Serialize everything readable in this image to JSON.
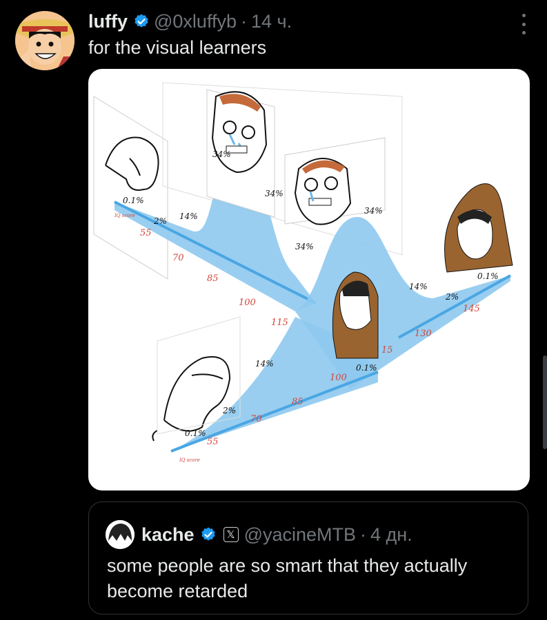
{
  "tweet": {
    "author_name": "luffy",
    "handle": "@0xluffyb",
    "time": "14 ч.",
    "separator": "·",
    "text": "for the visual learners",
    "avatar_icon": "avatar-straw-hat-icon",
    "verified_icon": "verified-badge-icon",
    "more_icon": "more-vertical-icon",
    "media": {
      "back_curve": {
        "percent_labels": [
          "0.1%",
          "2%",
          "14%",
          "34%",
          "34%"
        ],
        "iq_labels": [
          "IQ score",
          "55",
          "70",
          "85",
          "100",
          "115"
        ]
      },
      "mid_curve": {
        "percent_labels": [
          "34%",
          "34%",
          "14%",
          "2%",
          "0.1%"
        ],
        "iq_labels": [
          "130",
          "145"
        ]
      },
      "front_curve": {
        "percent_labels": [
          "0.1%",
          "2%",
          "14%",
          "0.1%"
        ],
        "iq_labels": [
          "IQ score",
          "55",
          "70",
          "85",
          "100",
          "15"
        ]
      }
    }
  },
  "quote": {
    "author_name": "kache",
    "handle": "@yacineMTB",
    "time": "4 дн.",
    "separator": "·",
    "text": "some people are so smart that they actually become retarded",
    "x_badge": "𝕏"
  },
  "colors": {
    "background": "#000000",
    "text": "#e7e9ea",
    "muted": "#71767b",
    "verified": "#1d9bf0",
    "curve": "#8ec9ee",
    "axis": "#4aa6e3",
    "iq_number": "#d0463b",
    "hood": "#9a6430"
  }
}
